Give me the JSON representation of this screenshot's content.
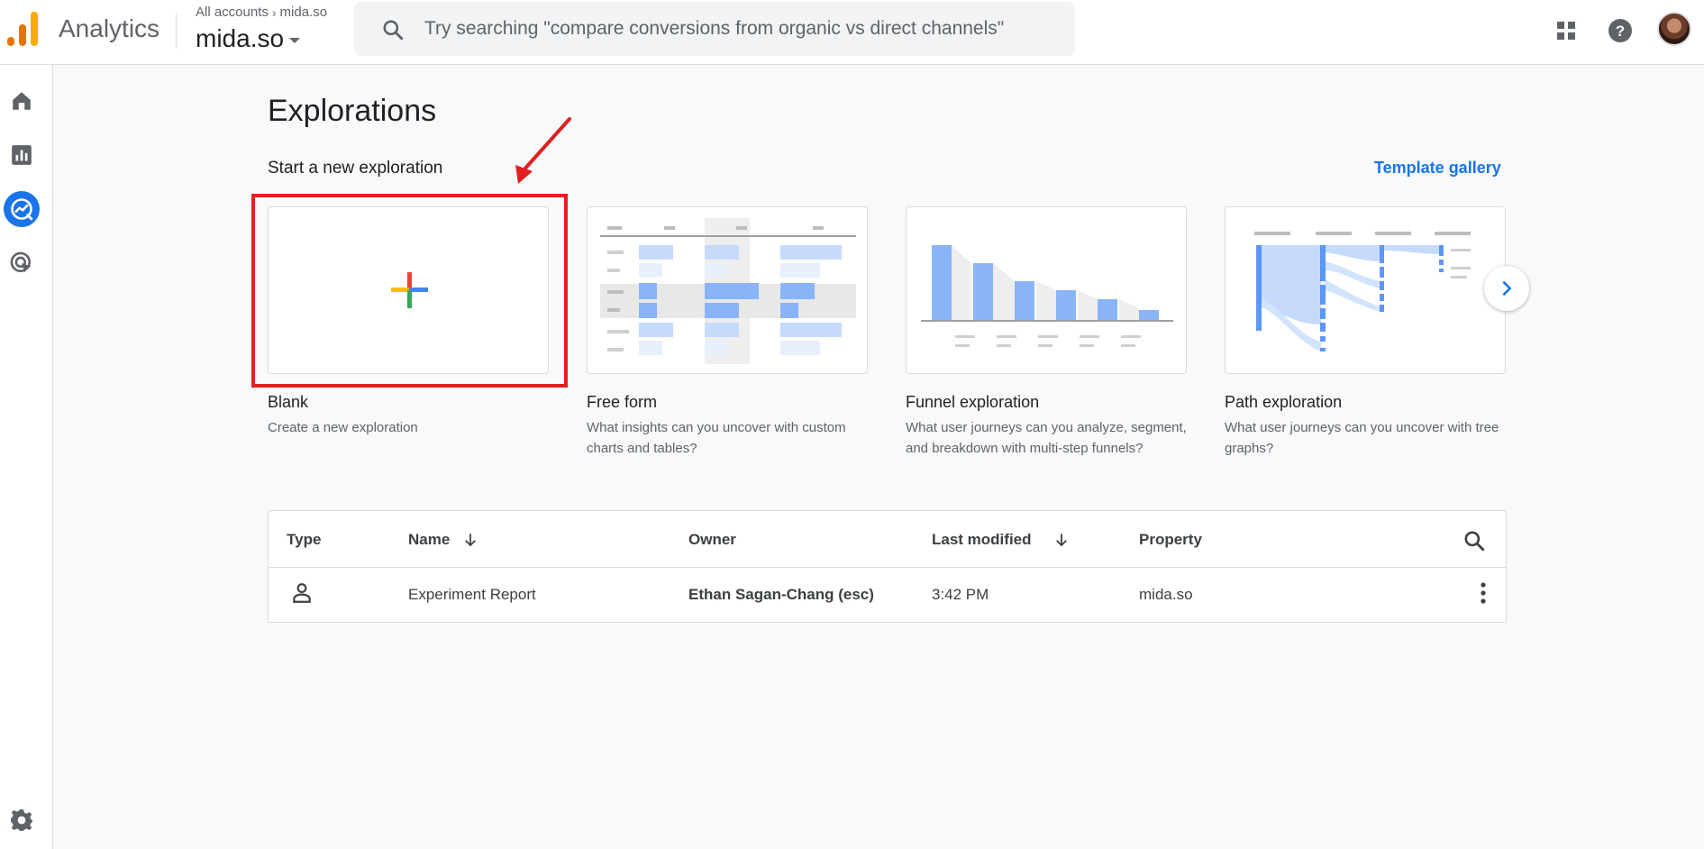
{
  "header": {
    "app_title": "Analytics",
    "breadcrumb_root": "All accounts",
    "breadcrumb_property": "mida.so",
    "property_name": "mida.so",
    "search_placeholder": "Try searching \"compare conversions from organic vs direct channels\""
  },
  "nav": {
    "items": [
      {
        "name": "home",
        "icon": "home-icon"
      },
      {
        "name": "reports",
        "icon": "bar-chart-icon"
      },
      {
        "name": "explore",
        "icon": "explore-icon",
        "active": true
      },
      {
        "name": "advertising",
        "icon": "target-icon"
      }
    ],
    "settings_icon": "gear-icon"
  },
  "main": {
    "title": "Explorations",
    "section_title": "Start a new exploration",
    "template_link": "Template gallery",
    "cards": [
      {
        "name": "Blank",
        "desc": "Create a new exploration"
      },
      {
        "name": "Free form",
        "desc": "What insights can you uncover with custom charts and tables?"
      },
      {
        "name": "Funnel exploration",
        "desc": "What user journeys can you analyze, segment, and breakdown with multi-step funnels?"
      },
      {
        "name": "Path exploration",
        "desc": "What user journeys can you uncover with tree graphs?"
      }
    ]
  },
  "table": {
    "headers": {
      "type": "Type",
      "name": "Name",
      "owner": "Owner",
      "last_modified": "Last modified",
      "property": "Property"
    },
    "rows": [
      {
        "name": "Experiment Report",
        "owner": "Ethan Sagan-Chang (esc)",
        "last_modified": "3:42 PM",
        "property": "mida.so"
      }
    ]
  },
  "colors": {
    "accent": "#1a73e8",
    "highlight": "#e02020"
  }
}
